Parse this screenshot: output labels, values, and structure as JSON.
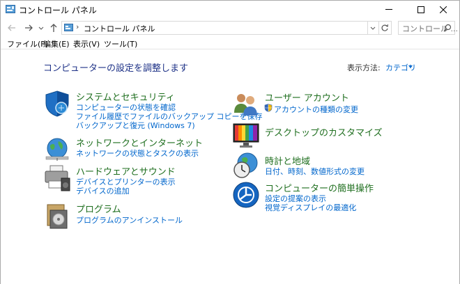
{
  "window": {
    "title": "コントロール パネル"
  },
  "address": {
    "path": "コントロール パネル",
    "search_placeholder": "コントロール ..."
  },
  "menu": {
    "items": [
      "ファイル(F)",
      "編集(E)",
      "表示(V)",
      "ツール(T)"
    ]
  },
  "main": {
    "heading": "コンピューターの設定を調整します",
    "view_by_label": "表示方法:",
    "view_by_value": "カテゴリ"
  },
  "categories": [
    {
      "title": "システムとセキュリティ",
      "icon": "system-security-shield-icon",
      "links": [
        "コンピューターの状態を確認",
        "ファイル履歴でファイルのバックアップ コピーを保存",
        "バックアップと復元 (Windows 7)"
      ]
    },
    {
      "title": "ネットワークとインターネット",
      "icon": "network-globe-icon",
      "links": [
        "ネットワークの状態とタスクの表示"
      ]
    },
    {
      "title": "ハードウェアとサウンド",
      "icon": "printer-speaker-icon",
      "links": [
        "デバイスとプリンターの表示",
        "デバイスの追加"
      ]
    },
    {
      "title": "プログラム",
      "icon": "programs-disc-icon",
      "links": [
        "プログラムのアンインストール"
      ]
    },
    {
      "title": "ユーザー アカウント",
      "icon": "users-icon",
      "links": [
        "アカウントの種類の変更"
      ]
    },
    {
      "title": "デスクトップのカスタマイズ",
      "icon": "desktop-monitor-icon",
      "links": []
    },
    {
      "title": "時計と地域",
      "icon": "clock-globe-icon",
      "links": [
        "日付、時刻、数値形式の変更"
      ]
    },
    {
      "title": "コンピューターの簡単操作",
      "icon": "ease-of-access-icon",
      "links": [
        "設定の提案の表示",
        "視覚ディスプレイの最適化"
      ]
    }
  ],
  "colors": {
    "link": "#0066cc",
    "category_title": "#1e6e1e",
    "heading": "#1e3287"
  }
}
